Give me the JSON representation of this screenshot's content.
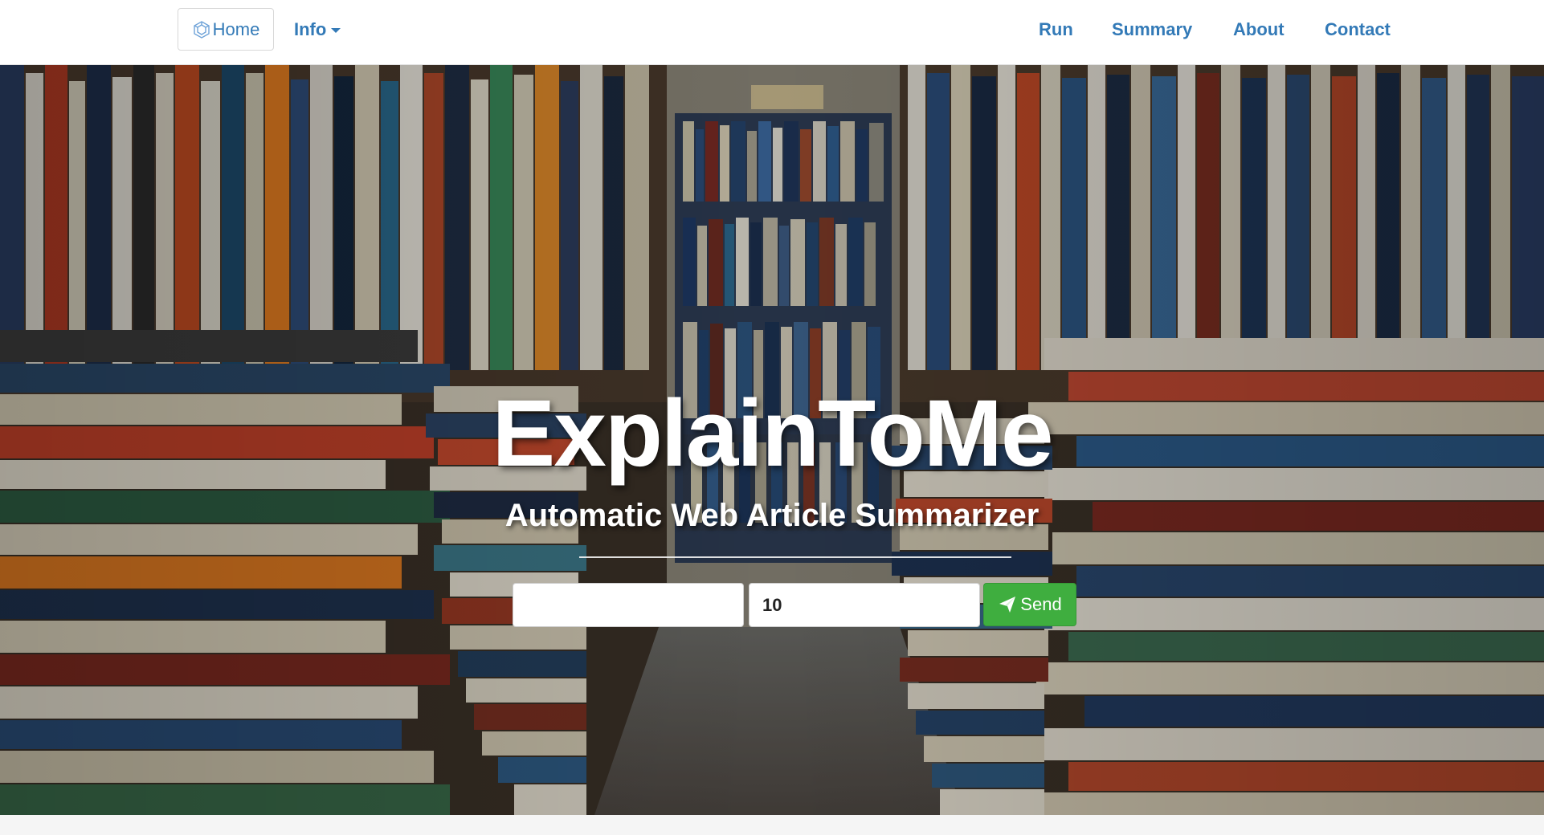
{
  "navbar": {
    "home_label": "Home",
    "home_icon": "home-hexagon-icon",
    "info_label": "Info",
    "links": {
      "run": "Run",
      "summary": "Summary",
      "about": "About",
      "contact": "Contact"
    },
    "link_color": "#337ab7"
  },
  "hero": {
    "background": "bookshelves-photo",
    "title": "ExplainToMe",
    "subtitle": "Automatic Web Article Summarizer"
  },
  "form": {
    "url_value": "",
    "url_placeholder": "",
    "count_value": "10",
    "send_label": "Send",
    "send_icon": "paper-plane-icon",
    "send_color": "#3fae3f"
  }
}
